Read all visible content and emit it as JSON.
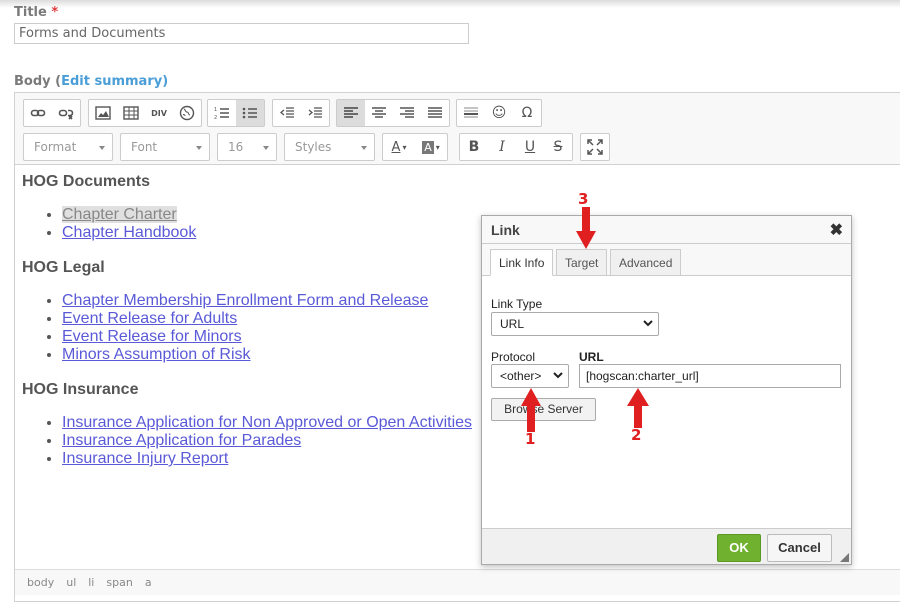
{
  "form": {
    "title_label": "Title",
    "required_mark": "*",
    "title_value": "Forms and Documents",
    "body_label": "Body (",
    "edit_summary": "Edit summary",
    "body_label_close": ")"
  },
  "toolbar": {
    "format": "Format",
    "font": "Font",
    "size": "16",
    "styles": "Styles",
    "font_color_label": "A",
    "bg_color_label": "A",
    "bold": "B",
    "italic": "I",
    "underline": "U",
    "strike": "S",
    "div_label": "DIV",
    "omega": "Ω",
    "smiley": "☺"
  },
  "content": {
    "sections": [
      {
        "heading": "HOG Documents",
        "links": [
          "Chapter Charter",
          "Chapter Handbook"
        ]
      },
      {
        "heading": "HOG Legal",
        "links": [
          "Chapter Membership Enrollment Form and Release",
          "Event Release for Adults",
          "Event Release for Minors",
          "Minors Assumption of Risk"
        ]
      },
      {
        "heading": "HOG Insurance",
        "links": [
          "Insurance Application for Non Approved or Open Activities",
          "Insurance Application for Parades",
          "Insurance Injury Report"
        ]
      }
    ]
  },
  "statusbar": [
    "body",
    "ul",
    "li",
    "span",
    "a"
  ],
  "dialog": {
    "title": "Link",
    "close": "✖",
    "tabs": [
      "Link Info",
      "Target",
      "Advanced"
    ],
    "link_type_label": "Link Type",
    "link_type_value": "URL",
    "protocol_label": "Protocol",
    "protocol_value": "<other>",
    "url_label": "URL",
    "url_value": "[hogscan:charter_url]",
    "browse_label": "Browse Server",
    "ok": "OK",
    "cancel": "Cancel"
  },
  "annotations": {
    "n1": "1",
    "n2": "2",
    "n3": "3"
  },
  "colors": {
    "accent_green": "#70b230",
    "annotation_red": "#e02020",
    "link": "#5a5ad8"
  }
}
